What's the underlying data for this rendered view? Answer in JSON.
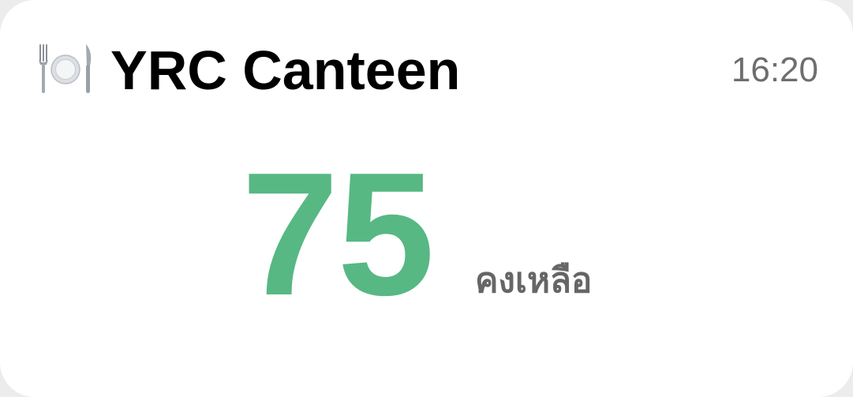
{
  "widget": {
    "title": "YRC Canteen",
    "icon": "fork-knife-plate-icon",
    "time": "16:20",
    "remaining_count": "75",
    "remaining_label": "คงเหลือ"
  },
  "colors": {
    "background": "#ffffff",
    "count": "#57b884",
    "label": "#666666",
    "time": "#6e6e6e",
    "title": "#000000"
  }
}
